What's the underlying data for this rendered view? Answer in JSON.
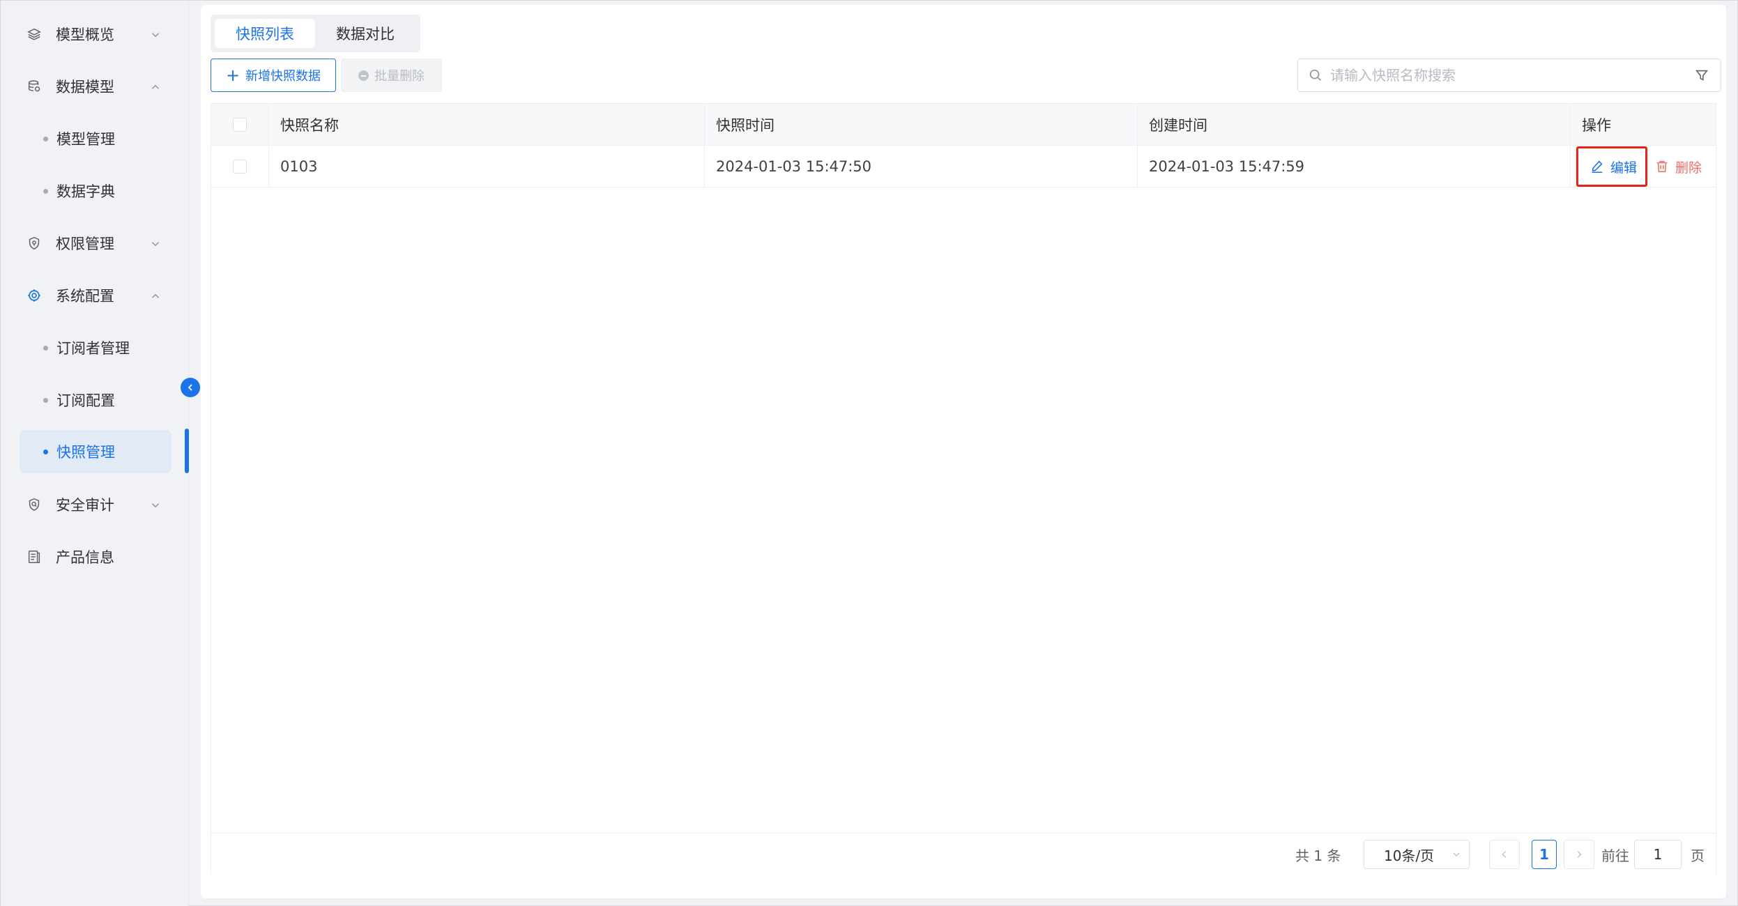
{
  "sidebar": {
    "items": [
      {
        "label": "模型概览",
        "icon": "layers-icon",
        "expanded": false
      },
      {
        "label": "数据模型",
        "icon": "database-icon",
        "expanded": true,
        "children": [
          {
            "label": "模型管理"
          },
          {
            "label": "数据字典"
          }
        ]
      },
      {
        "label": "权限管理",
        "icon": "shield-icon",
        "expanded": false
      },
      {
        "label": "系统配置",
        "icon": "settings-icon",
        "expanded": true,
        "children": [
          {
            "label": "订阅者管理"
          },
          {
            "label": "订阅配置"
          },
          {
            "label": "快照管理",
            "active": true
          }
        ]
      },
      {
        "label": "安全审计",
        "icon": "audit-shield-icon",
        "expanded": false
      },
      {
        "label": "产品信息",
        "icon": "document-icon"
      }
    ]
  },
  "tabs": [
    {
      "label": "快照列表",
      "active": true
    },
    {
      "label": "数据对比"
    }
  ],
  "toolbar": {
    "add_label": "新增快照数据",
    "batch_delete_label": "批量删除"
  },
  "search": {
    "placeholder": "请输入快照名称搜索",
    "value": ""
  },
  "table": {
    "columns": [
      "快照名称",
      "快照时间",
      "创建时间",
      "操作"
    ],
    "rows": [
      {
        "name": "0103",
        "snapshot_time": "2024-01-03 15:47:50",
        "created_time": "2024-01-03 15:47:59"
      }
    ],
    "actions": {
      "edit": "编辑",
      "delete": "删除"
    }
  },
  "pagination": {
    "total_text": "共 1 条",
    "page_size": "10条/页",
    "current_page": "1",
    "goto_label": "前往",
    "goto_value": "1",
    "goto_suffix": "页"
  },
  "colors": {
    "accent": "#1a73e8",
    "danger": "#f56c6c",
    "highlight_box": "#e8221b"
  }
}
